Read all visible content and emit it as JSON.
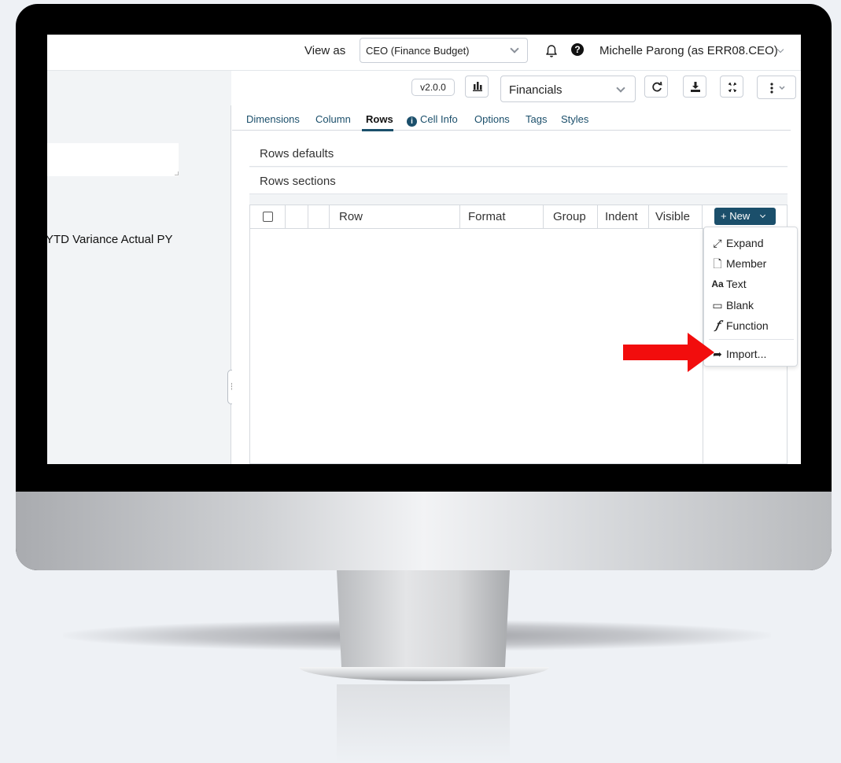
{
  "topbar": {
    "view_as_label": "View as",
    "role_value": "CEO (Finance Budget)",
    "help_glyph": "?",
    "user_name": "Michelle Parong (as ERR08.CEO)"
  },
  "toolbar": {
    "version": "v2.0.0",
    "report_value": "Financials"
  },
  "preview": {
    "column_headers": "YTD Variance  Actual PY"
  },
  "splitter": {
    "handle_glyph": "⋮"
  },
  "tabs": [
    {
      "label": "Dimensions"
    },
    {
      "label": "Column"
    },
    {
      "label": "Rows"
    },
    {
      "label": "Cell Info"
    },
    {
      "label": "Options"
    },
    {
      "label": "Tags"
    },
    {
      "label": "Styles"
    }
  ],
  "info_glyph": "i",
  "accordion": {
    "defaults": "Rows defaults",
    "sections": "Rows sections"
  },
  "grid": {
    "columns": [
      "Row",
      "Format",
      "Group",
      "Indent",
      "Visible"
    ],
    "new_button": "+ New"
  },
  "menu": {
    "items": [
      {
        "icon": "⤢",
        "label": "Expand"
      },
      {
        "icon": "🗋",
        "label": "Member"
      },
      {
        "icon": "Aa",
        "label": "Text"
      },
      {
        "icon": "▭",
        "label": "Blank"
      },
      {
        "icon": "𝑓",
        "label": "Function"
      },
      {
        "icon": "➦",
        "label": "Import..."
      }
    ]
  },
  "colors": {
    "accent": "#1b4f6b",
    "arrow": "#f20d0d"
  }
}
